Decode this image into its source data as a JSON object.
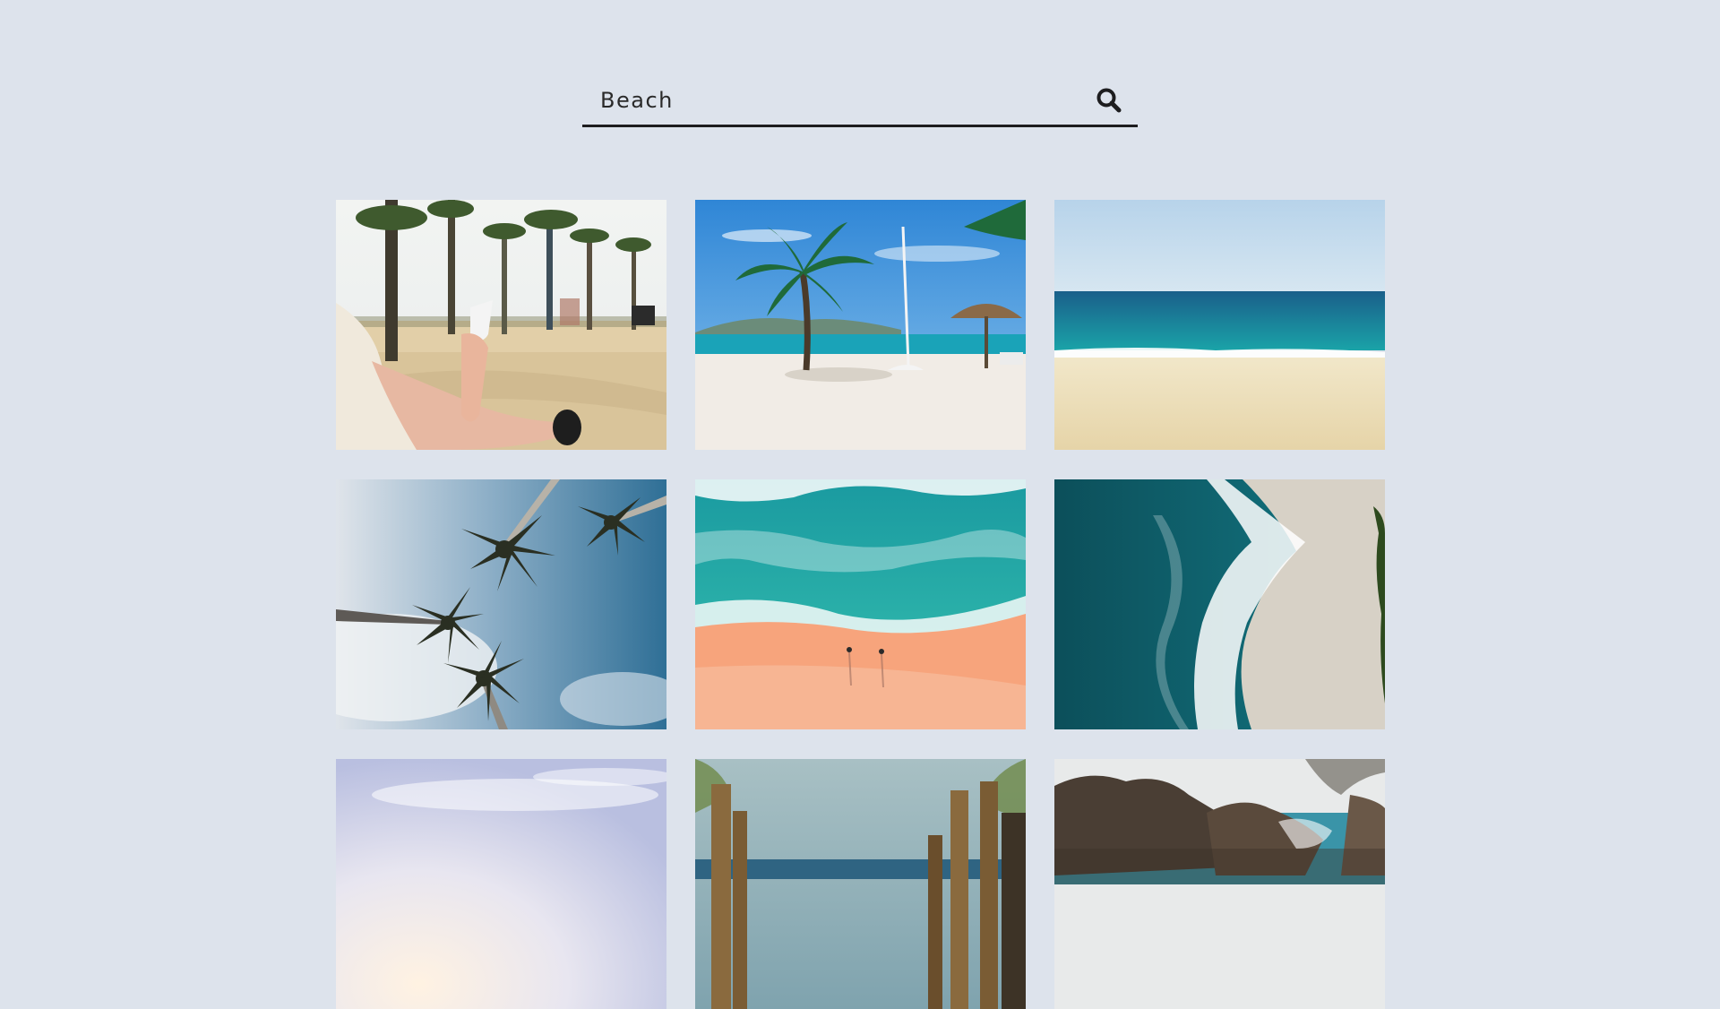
{
  "search": {
    "value": "Beach",
    "icon": "search-icon"
  },
  "gallery": {
    "photos": [
      {
        "subject": "person-with-cup-under-palms"
      },
      {
        "subject": "palm-tree-and-umbrella-on-beach"
      },
      {
        "subject": "calm-sea-and-sand"
      },
      {
        "subject": "palm-trees-from-below"
      },
      {
        "subject": "aerial-waves-peach-sand"
      },
      {
        "subject": "aerial-turquoise-waves-white-sand"
      },
      {
        "subject": "hazy-sky"
      },
      {
        "subject": "wooden-posts-to-sea"
      },
      {
        "subject": "rocky-cliff-coast"
      }
    ]
  },
  "colors": {
    "background": "#dde3ec",
    "underline": "#1d1d1f"
  }
}
